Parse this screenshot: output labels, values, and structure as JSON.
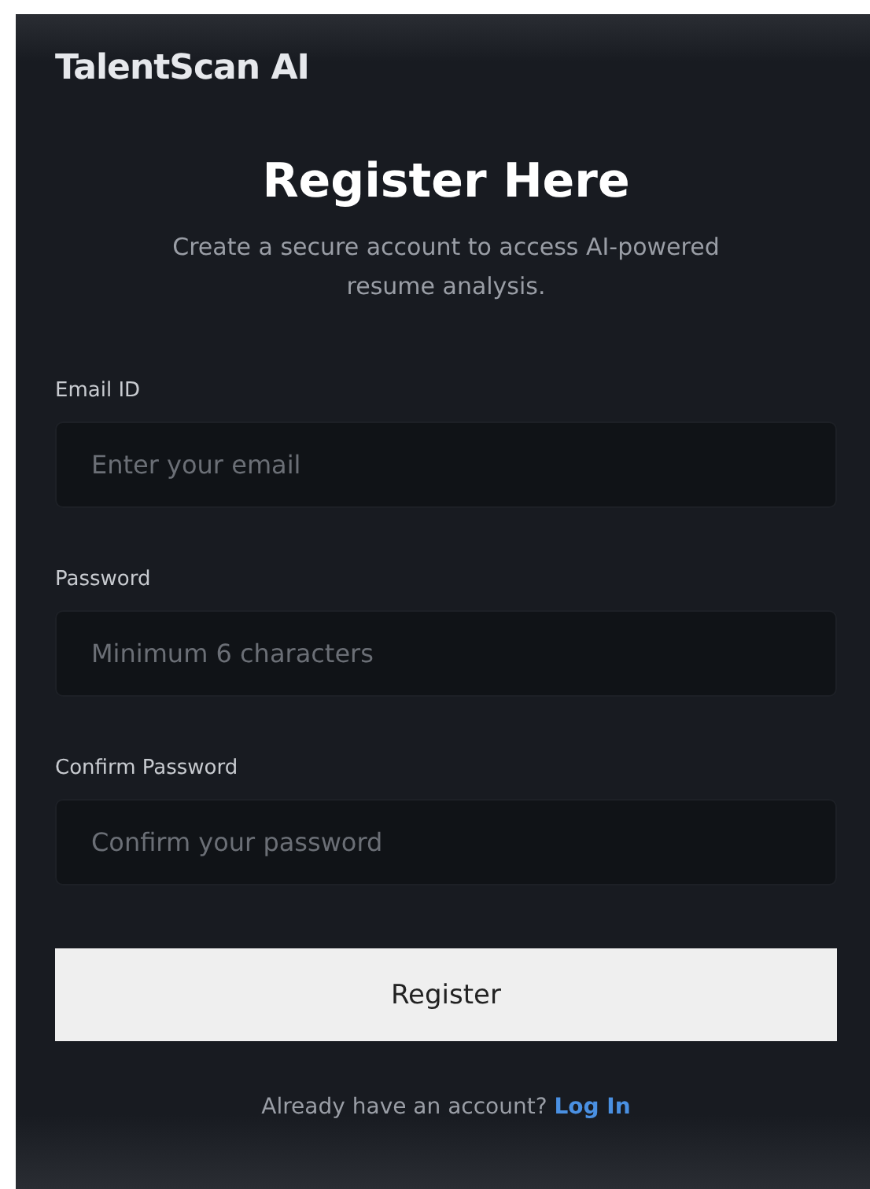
{
  "brand": "TalentScan AI",
  "heading": "Register Here",
  "subtitle": "Create a secure account to access AI-powered resume analysis.",
  "fields": [
    {
      "label": "Email ID",
      "placeholder": "Enter your email"
    },
    {
      "label": "Password",
      "placeholder": "Minimum 6 characters"
    },
    {
      "label": "Confirm Password",
      "placeholder": "Confirm your password"
    }
  ],
  "submit": "Register",
  "footer": {
    "text": "Already have an account?",
    "link": "Log In"
  }
}
